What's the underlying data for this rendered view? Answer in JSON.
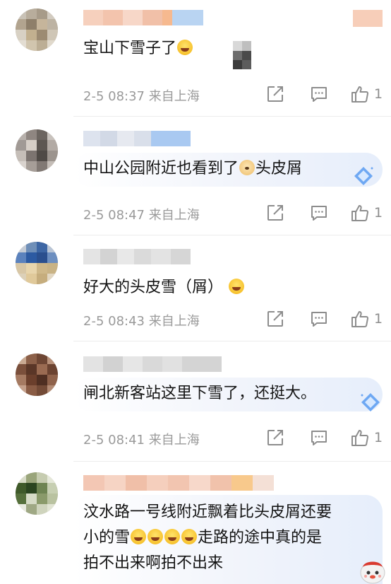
{
  "comments": [
    {
      "text": "宝山下雪子了",
      "timestamp": "2-5 08:37 来自上海",
      "likes": "1"
    },
    {
      "text": "中山公园附近也看到了",
      "text_after_emoji": "头皮屑",
      "timestamp": "2-5 08:47 来自上海",
      "likes": "1"
    },
    {
      "text": "好大的头皮雪（屑）",
      "timestamp": "2-5 08:43 来自上海",
      "likes": "1"
    },
    {
      "text": "闸北新客站这里下雪了，还挺大。",
      "timestamp": "2-5 08:41 来自上海",
      "likes": "1"
    },
    {
      "line1": "汶水路一号线附近飘着比头皮屑还要",
      "line2_start": "小的雪",
      "line2_end": "走路的途中真的是",
      "line3": "拍不出来啊拍不出来"
    }
  ],
  "icons": {
    "share": "share-icon",
    "reply": "comment-icon",
    "like": "thumbs-up-icon",
    "laugh": "laughing-emoji-icon",
    "dog": "dog-emoji-icon",
    "badge": "diamond-badge-icon"
  },
  "colors": {
    "meta_text": "#9a9a9a",
    "bubble": "#e6eefb",
    "badge": "#6ea8f3"
  }
}
